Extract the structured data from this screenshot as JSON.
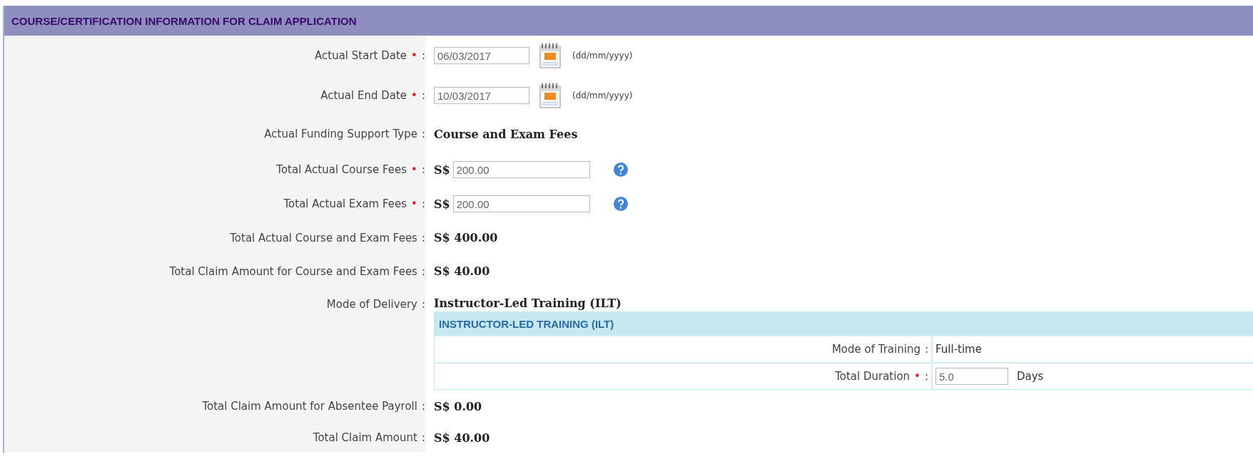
{
  "section": {
    "title": "COURSE/CERTIFICATION INFORMATION FOR CLAIM APPLICATION"
  },
  "required_symbol": "•",
  "separator": ":",
  "rows": [
    {
      "kind": "date",
      "label": "Actual Start Date",
      "required": true,
      "value": "06/03/2017",
      "hint": "(dd/mm/yyyy)"
    },
    {
      "kind": "date",
      "label": "Actual End Date",
      "required": true,
      "value": "10/03/2017",
      "hint": "(dd/mm/yyyy)"
    },
    {
      "kind": "text",
      "label": "Actual Funding Support Type",
      "required": false,
      "value": "Course and Exam Fees"
    },
    {
      "kind": "money",
      "label": "Total Actual Course Fees",
      "required": true,
      "currency": "S$",
      "value": "200.00"
    },
    {
      "kind": "money",
      "label": "Total Actual Exam Fees",
      "required": true,
      "currency": "S$",
      "value": "200.00"
    },
    {
      "kind": "text",
      "label": "Total Actual Course and Exam Fees",
      "required": false,
      "value": "S$ 400.00"
    },
    {
      "kind": "text",
      "label": "Total Claim Amount for Course and Exam Fees",
      "required": false,
      "value": "S$ 40.00"
    },
    {
      "kind": "mode",
      "label": "Mode of Delivery",
      "required": false,
      "value": "Instructor-Led Training (ILT)",
      "panel": {
        "title": "INSTRUCTOR-LED TRAINING (ILT)",
        "rows": [
          {
            "kind": "text",
            "label": "Mode of Training",
            "required": false,
            "value": "Full-time"
          },
          {
            "kind": "input",
            "label": "Total Duration",
            "required": true,
            "value": "5.0",
            "unit": "Days"
          }
        ]
      }
    },
    {
      "kind": "text",
      "label": "Total Claim Amount for Absentee Payroll",
      "required": false,
      "value": "S$ 0.00"
    },
    {
      "kind": "text",
      "label": "Total Claim Amount",
      "required": false,
      "value": "S$ 40.00"
    }
  ]
}
